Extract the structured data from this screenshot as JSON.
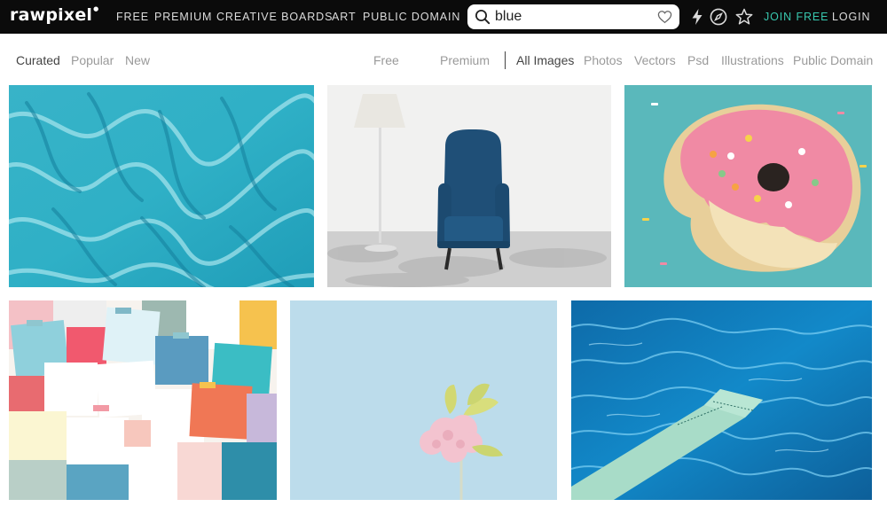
{
  "header": {
    "logo": "rawpixel",
    "nav": [
      "FREE",
      "PREMIUM",
      "CREATIVE BOARDS",
      "ART",
      "PUBLIC DOMAIN"
    ],
    "search": {
      "value": "blue"
    },
    "join_label": "JOIN FREE",
    "login_label": "LOGIN",
    "icons": [
      "search-icon",
      "heart-icon",
      "lightning-icon",
      "compass-icon",
      "star-icon"
    ],
    "colors": {
      "bar": "#0b0b0b",
      "join": "#38c7ae"
    }
  },
  "sort_tabs": [
    "Curated",
    "Popular",
    "New"
  ],
  "license_tabs": [
    "Free",
    "Premium"
  ],
  "type_tabs": [
    "All Images",
    "Photos",
    "Vectors",
    "Psd",
    "Illustrations",
    "Public Domain"
  ],
  "active": {
    "sort": "Curated",
    "type": "All Images"
  },
  "images": [
    "aerial-turquoise-sand-patterns",
    "blue-armchair-with-floor-lamp",
    "pink-frosted-donut-on-blue",
    "colorful-sticky-notes-collage",
    "pink-flower-on-light-blue",
    "diving-board-over-blue-pool"
  ]
}
